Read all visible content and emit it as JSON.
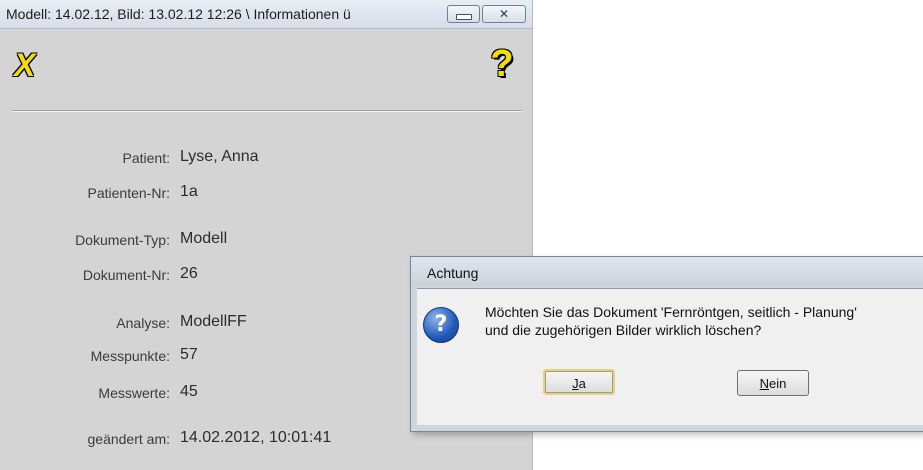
{
  "info_window": {
    "title": "Modell: 14.02.12,  Bild: 13.02.12  12:26 \\ Informationen ü",
    "tools": {
      "close_glyph": "X",
      "help_glyph": "?"
    },
    "fields": [
      {
        "label": "Patient:",
        "value": "Lyse, Anna"
      },
      {
        "label": "Patienten-Nr:",
        "value": "1a"
      },
      {
        "label": "Dokument-Typ:",
        "value": "Modell"
      },
      {
        "label": "Dokument-Nr:",
        "value": "26"
      },
      {
        "label": "Analyse:",
        "value": "ModellFF"
      },
      {
        "label": "Messpunkte:",
        "value": "57"
      },
      {
        "label": "Messwerte:",
        "value": "45"
      },
      {
        "label": "geändert am:",
        "value": "14.02.2012, 10:01:41"
      }
    ]
  },
  "dialog": {
    "title": "Achtung",
    "icon_glyph": "?",
    "message_line1": "Möchten Sie das Dokument 'Fernröntgen, seitlich - Planung'",
    "message_line2": "und die zugehörigen Bilder wirklich löschen?",
    "yes_access": "J",
    "yes_rest": "a",
    "no_access": "N",
    "no_rest": "ein"
  },
  "colors": {
    "window_bg": "#d4d4d4",
    "icon_yellow": "#f2df00",
    "dialog_bg": "#f0f0f0"
  }
}
